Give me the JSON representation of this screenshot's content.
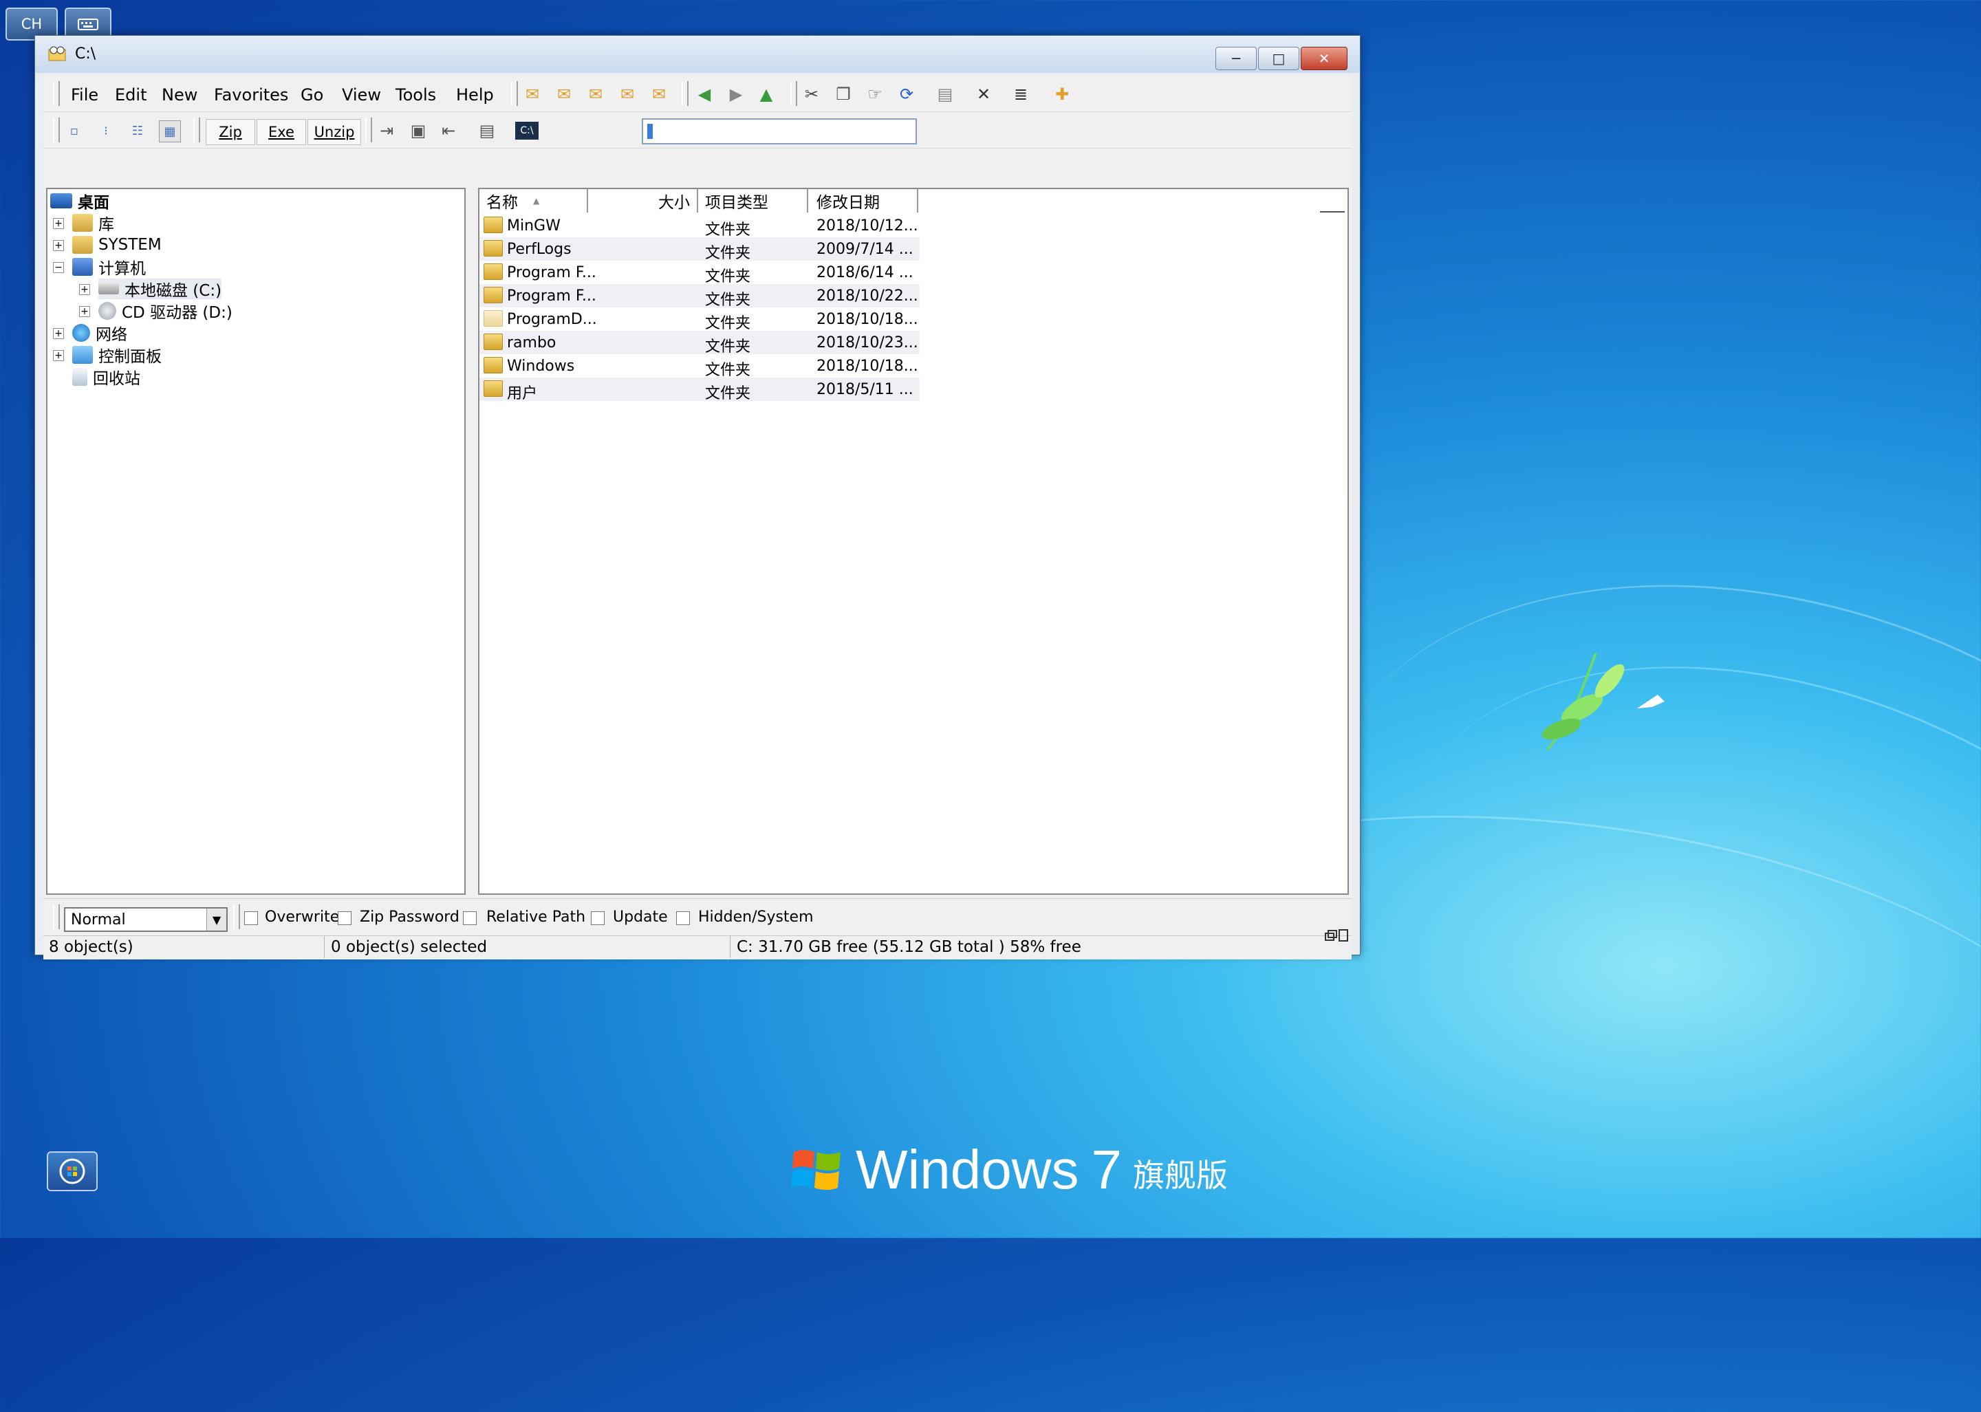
{
  "desktop": {
    "lang_button": "CH",
    "keyboard_icon": "keyboard-icon",
    "branding_text": "Windows",
    "branding_version": "7",
    "branding_edition": "旗舰版"
  },
  "window": {
    "title": "C:\\",
    "minimize": "─",
    "maximize": "□",
    "close": "✕"
  },
  "menu": [
    "File",
    "Edit",
    "New",
    "Favorites",
    "Go",
    "View",
    "Tools",
    "Help"
  ],
  "toolbar2": {
    "zip": "Zip",
    "exe": "Exe",
    "unzip": "Unzip",
    "address_value": ""
  },
  "tree": {
    "root": "桌面",
    "items": [
      {
        "label": "库",
        "icon": "library-icon"
      },
      {
        "label": "SYSTEM",
        "icon": "user-folder-icon"
      },
      {
        "label": "计算机",
        "icon": "computer-icon"
      },
      {
        "label": "本地磁盘 (C:)",
        "icon": "drive-icon"
      },
      {
        "label": "CD 驱动器 (D:)",
        "icon": "cd-drive-icon"
      },
      {
        "label": "网络",
        "icon": "network-icon"
      },
      {
        "label": "控制面板",
        "icon": "control-panel-icon"
      },
      {
        "label": "回收站",
        "icon": "recycle-bin-icon"
      }
    ]
  },
  "list": {
    "columns": [
      "名称",
      "大小",
      "项目类型",
      "修改日期"
    ],
    "rows": [
      {
        "name": "MinGW",
        "size": "",
        "type": "文件夹",
        "date": "2018/10/12..."
      },
      {
        "name": "PerfLogs",
        "size": "",
        "type": "文件夹",
        "date": "2009/7/14 ..."
      },
      {
        "name": "Program F...",
        "size": "",
        "type": "文件夹",
        "date": "2018/6/14 ..."
      },
      {
        "name": "Program F...",
        "size": "",
        "type": "文件夹",
        "date": "2018/10/22..."
      },
      {
        "name": "ProgramD...",
        "size": "",
        "type": "文件夹",
        "date": "2018/10/18..."
      },
      {
        "name": "rambo",
        "size": "",
        "type": "文件夹",
        "date": "2018/10/23..."
      },
      {
        "name": "Windows",
        "size": "",
        "type": "文件夹",
        "date": "2018/10/18..."
      },
      {
        "name": "用户",
        "size": "",
        "type": "文件夹",
        "date": "2018/5/11 ..."
      }
    ]
  },
  "options": {
    "compression": "Normal",
    "overwrite": "Overwrite",
    "zip_password": "Zip Password",
    "relative_path": "Relative Path",
    "update": "Update",
    "hidden_system": "Hidden/System"
  },
  "status": {
    "objects": "8 object(s)",
    "selected": "0 object(s) selected",
    "free": "C: 31.70 GB free (55.12 GB total )   58% free"
  },
  "colors": {
    "folder": "#e3b23c",
    "close_button": "#c8442c",
    "desktop_accent": "#1a86d8"
  }
}
